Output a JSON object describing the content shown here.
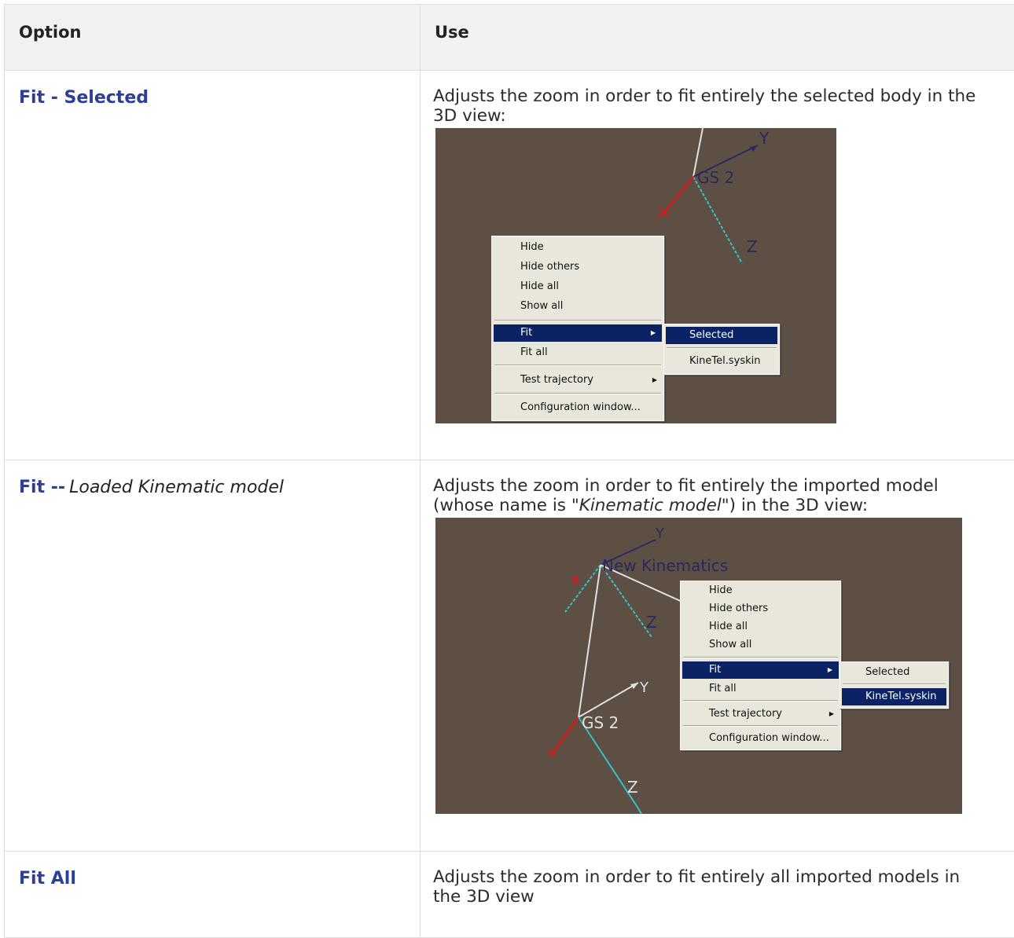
{
  "table": {
    "headers": [
      "Option",
      "Use"
    ],
    "rows": [
      {
        "option": "Fit - Selected",
        "use": "Adjusts the zoom in order to fit entirely the selected body in the 3D view:"
      },
      {
        "option": "Fit --",
        "option_italic": "Loaded Kinematic model",
        "use_pre": "Adjusts the zoom in order to fit entirely the imported model (whose name is \"",
        "use_italic": "Kinematic model",
        "use_post": "\") in the 3D view:"
      },
      {
        "option": "Fit All",
        "use": "Adjusts the zoom in order to fit entirely all imported models in the 3D view"
      }
    ]
  },
  "screenshot1": {
    "axis_labels": {
      "y": "Y",
      "z": "Z",
      "frame": "GS 2"
    },
    "menu": [
      "Hide",
      "Hide others",
      "Hide all",
      "Show all",
      "Fit",
      "Fit all",
      "Test trajectory",
      "Configuration window..."
    ],
    "submenu": [
      "Selected",
      "KineTel.syskin"
    ]
  },
  "screenshot2": {
    "axis_labels": {
      "y1": "Y",
      "z1": "Z",
      "frame1": "New Kinematics",
      "y2": "Y",
      "z2": "Z",
      "frame2": "GS 2"
    },
    "menu": [
      "Hide",
      "Hide others",
      "Hide all",
      "Show all",
      "Fit",
      "Fit all",
      "Test trajectory",
      "Configuration window..."
    ],
    "submenu": [
      "Selected",
      "KineTel.syskin"
    ]
  },
  "colors": {
    "link": "#2b3e98",
    "viewport_bg": "#5d4f43",
    "menu_bg": "#e9e7dc",
    "menu_highlight": "#0b2265"
  }
}
